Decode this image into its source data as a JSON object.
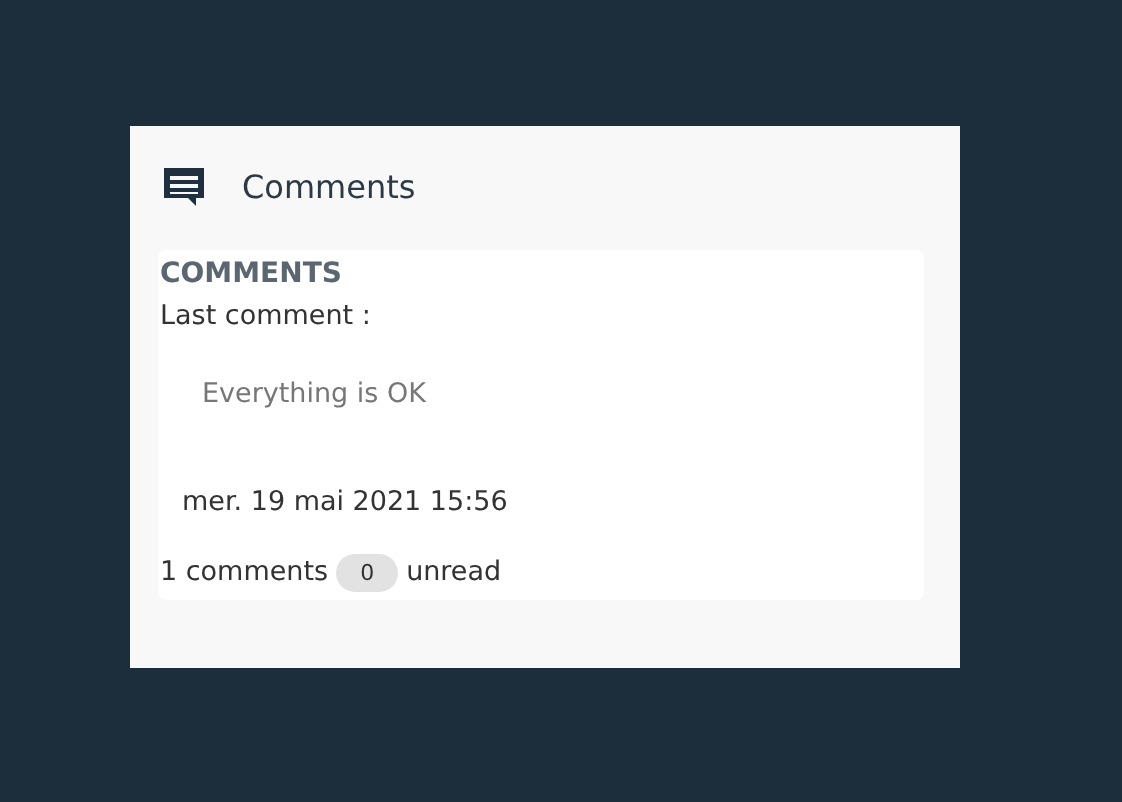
{
  "panel": {
    "title": "Comments"
  },
  "card": {
    "heading": "COMMENTS",
    "label": "Last comment :",
    "comment": "Everything is OK",
    "date": "mer. 19 mai 2021 15:56",
    "count_text": "1 comments",
    "unread_count": "0",
    "unread_label": "unread"
  }
}
